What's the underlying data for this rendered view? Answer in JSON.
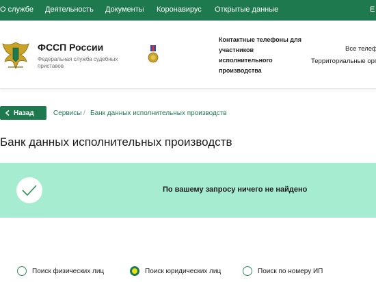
{
  "topnav": {
    "items": [
      "О службе",
      "Деятельность",
      "Документы",
      "Коронавирус",
      "Открытые данные"
    ],
    "partial_right": "E"
  },
  "header": {
    "title": "ФССП России",
    "subtitle": "Федеральная служба судебных приставов",
    "contacts_link": "Контактные телефоны для участников исполнительного производства",
    "phones_line1": "Все телефо",
    "phones_line2": "Территориальные орга"
  },
  "breadcrumb": {
    "back_label": "Назад",
    "items": [
      "Сервисы",
      "Банк данных исполнительных производств"
    ],
    "separator": "/"
  },
  "page": {
    "title": "Банк данных исполнительных производств"
  },
  "result": {
    "message": "По вашему запросу ничего не найдено"
  },
  "search_modes": {
    "options": [
      "Поиск физических лиц",
      "Поиск юридических лиц",
      "Поиск по номеру ИП"
    ],
    "selected": "Поиск юридических лиц"
  },
  "colors": {
    "brand_green": "#1e7a4e",
    "result_bg": "#a6ecd0",
    "radio_selected_fill": "#e8e21a"
  }
}
